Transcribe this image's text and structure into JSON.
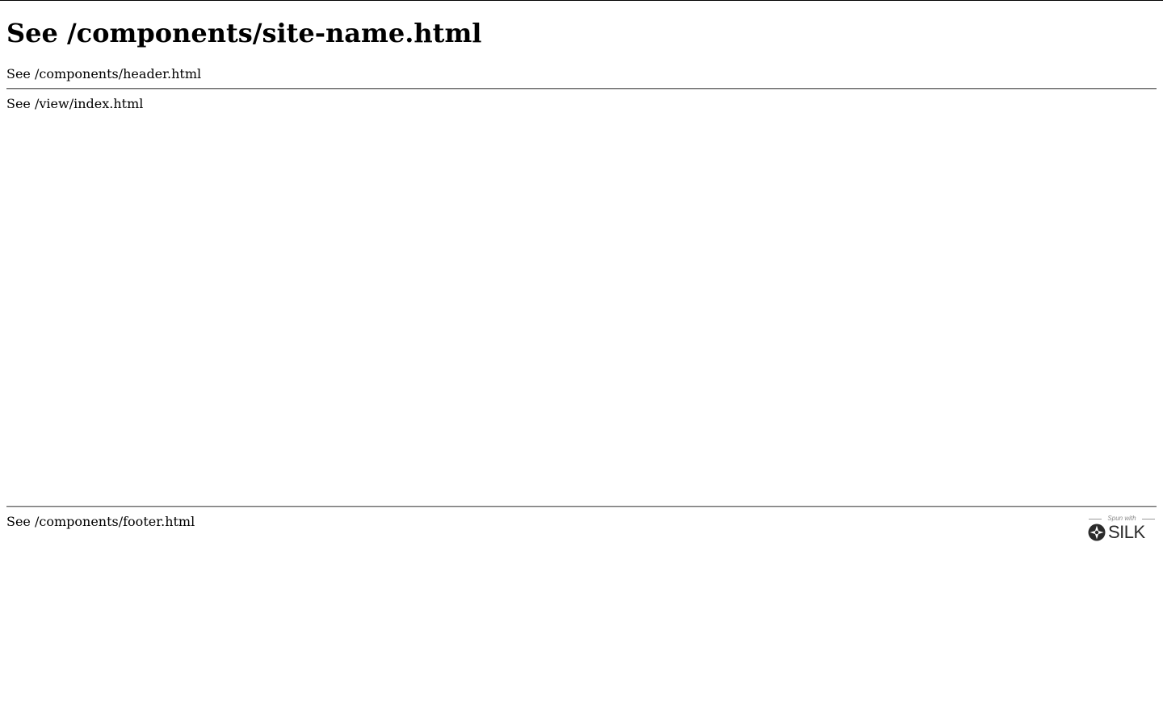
{
  "page": {
    "site_name": "See /components/site-name.html",
    "header_text": "See /components/header.html",
    "main_text": "See /view/index.html",
    "footer_text": "See /components/footer.html"
  },
  "badge": {
    "spun_with": "Spun with",
    "wordmark": "SILK",
    "icon": "silk-logo-icon"
  }
}
